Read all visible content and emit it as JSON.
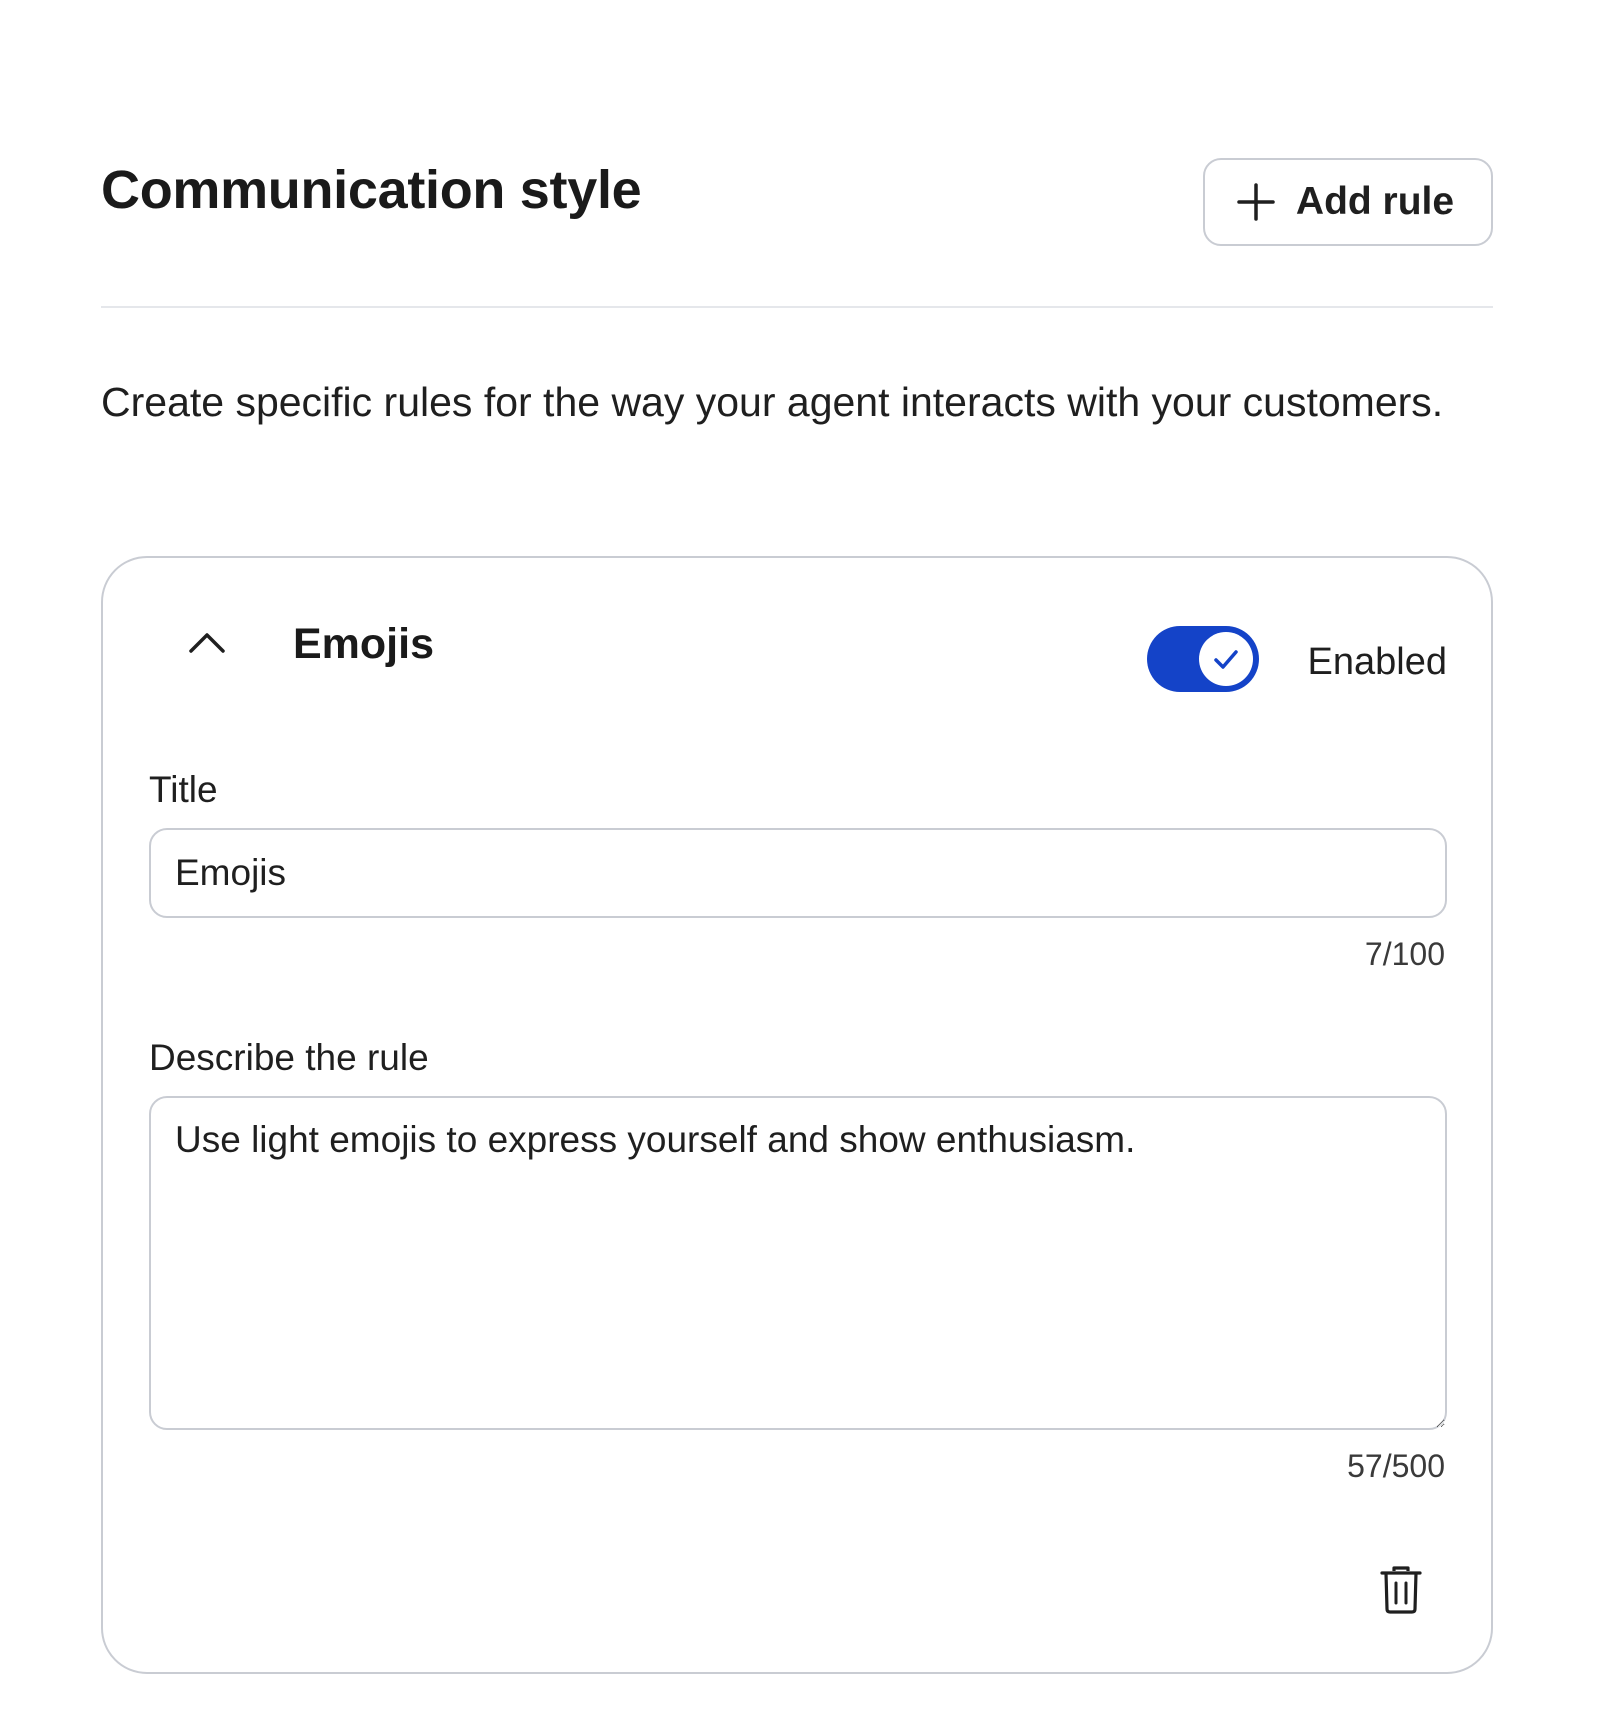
{
  "section": {
    "title": "Communication style",
    "add_rule_label": "Add rule",
    "description": "Create specific rules for the way your agent interacts with your customers."
  },
  "rule": {
    "name": "Emojis",
    "status_label": "Enabled",
    "enabled": true,
    "title_field": {
      "label": "Title",
      "value": "Emojis",
      "counter": "7/100"
    },
    "description_field": {
      "label": "Describe the rule",
      "value": "Use light emojis to express yourself and show enthusiasm.",
      "counter": "57/500"
    }
  },
  "icons": {
    "add": "plus-icon",
    "collapse": "chevron-up-icon",
    "toggle_check": "check-icon",
    "delete": "trash-icon"
  },
  "colors": {
    "toggle_on": "#1443c8",
    "border": "#c9ccd3",
    "divider": "#e5e7eb"
  }
}
